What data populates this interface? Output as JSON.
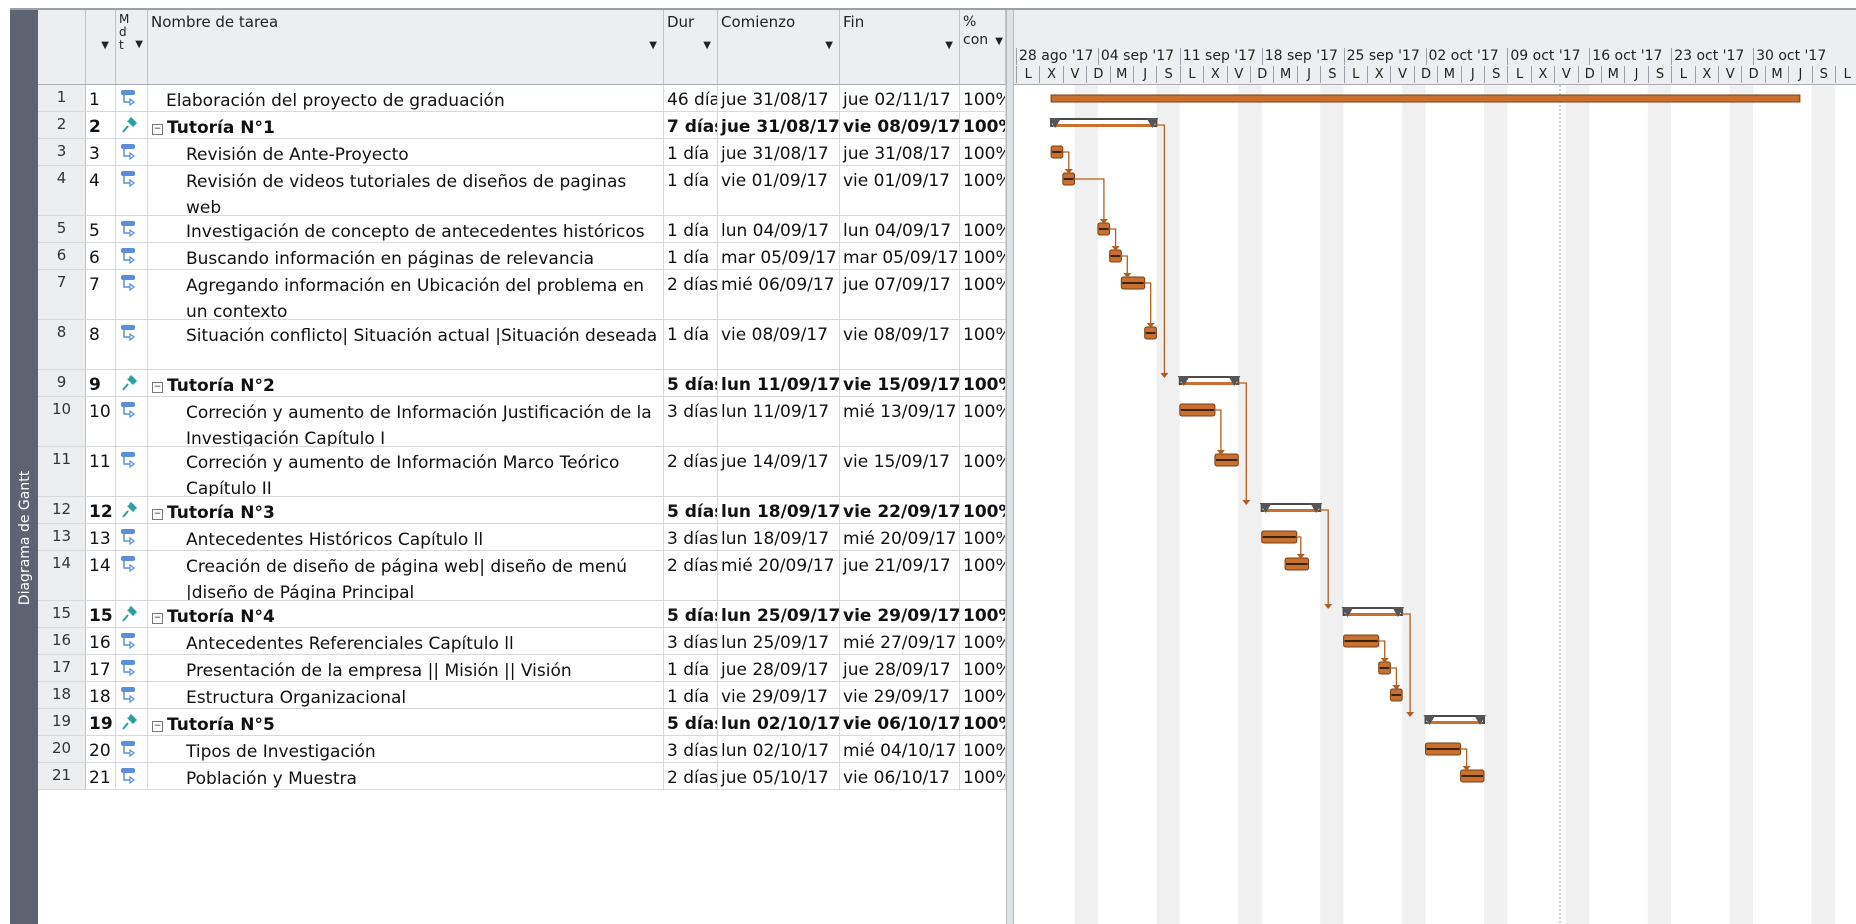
{
  "view_label": "Diagrama de Gantt",
  "columns": {
    "id_header": "",
    "mode_header": "M d t",
    "name_header": "Nombre de tarea",
    "dur_header": "Dur",
    "start_header": "Comienzo",
    "finish_header": "Fin",
    "pct_header": "% con"
  },
  "timescale": {
    "weeks": [
      "28 ago '17",
      "04 sep '17",
      "11 sep '17",
      "18 sep '17",
      "25 sep '17",
      "02 oct '17",
      "09 oct '17",
      "16 oct '17",
      "23 oct '17",
      "30 oct '17"
    ],
    "days": [
      "L",
      "X",
      "V",
      "D",
      "M",
      "J",
      "S"
    ]
  },
  "colors": {
    "bar": "#c8702f",
    "summary_bar": "#4a4a4a",
    "link": "#b35e1e",
    "weekend": "#f0f0f0"
  },
  "tasks": [
    {
      "row": "1",
      "id": "1",
      "name": "Elaboración del proyecto de graduación",
      "dur": "46 días",
      "start": "jue 31/08/17",
      "finish": "jue 02/11/17",
      "pct": "100%",
      "summary": false,
      "level": 0,
      "mode_icon": "auto-scheduled-icon"
    },
    {
      "row": "2",
      "id": "2",
      "name": "Tutoría N°1",
      "dur": "7 días",
      "start": "jue 31/08/17",
      "finish": "vie 08/09/17",
      "pct": "100%",
      "summary": true,
      "level": 0,
      "mode_icon": "manual-pin-icon"
    },
    {
      "row": "3",
      "id": "3",
      "name": "Revisión de Ante-Proyecto",
      "dur": "1 día",
      "start": "jue 31/08/17",
      "finish": "jue 31/08/17",
      "pct": "100%",
      "summary": false,
      "level": 1,
      "mode_icon": "auto-scheduled-icon"
    },
    {
      "row": "4",
      "id": "4",
      "name": "Revisión de videos tutoriales  de diseños de paginas web",
      "dur": "1 día",
      "start": "vie 01/09/17",
      "finish": "vie 01/09/17",
      "pct": "100%",
      "summary": false,
      "level": 1,
      "mode_icon": "auto-scheduled-icon"
    },
    {
      "row": "5",
      "id": "5",
      "name": "Investigación de concepto de antecedentes históricos",
      "dur": "1 día",
      "start": "lun 04/09/17",
      "finish": "lun 04/09/17",
      "pct": "100%",
      "summary": false,
      "level": 1,
      "mode_icon": "auto-scheduled-icon"
    },
    {
      "row": "6",
      "id": "6",
      "name": "Buscando información en páginas de relevancia",
      "dur": "1 día",
      "start": "mar 05/09/17",
      "finish": "mar 05/09/17",
      "pct": "100%",
      "summary": false,
      "level": 1,
      "mode_icon": "auto-scheduled-icon"
    },
    {
      "row": "7",
      "id": "7",
      "name": "Agregando información en Ubicación del problema en un contexto",
      "dur": "2 días",
      "start": "mié 06/09/17",
      "finish": "jue 07/09/17",
      "pct": "100%",
      "summary": false,
      "level": 1,
      "mode_icon": "auto-scheduled-icon"
    },
    {
      "row": "8",
      "id": "8",
      "name": "Situación conflicto| Situación actual |Situación deseada",
      "dur": "1 día",
      "start": "vie 08/09/17",
      "finish": "vie 08/09/17",
      "pct": "100%",
      "summary": false,
      "level": 1,
      "mode_icon": "auto-scheduled-icon"
    },
    {
      "row": "9",
      "id": "9",
      "name": "Tutoría N°2",
      "dur": "5 días",
      "start": "lun 11/09/17",
      "finish": "vie 15/09/17",
      "pct": "100%",
      "summary": true,
      "level": 0,
      "mode_icon": "manual-pin-icon"
    },
    {
      "row": "10",
      "id": "10",
      "name": "Correción y aumento de Información Justificación de la Investigación Capítulo I",
      "dur": "3 días",
      "start": "lun 11/09/17",
      "finish": "mié 13/09/17",
      "pct": "100%",
      "summary": false,
      "level": 1,
      "mode_icon": "auto-scheduled-icon"
    },
    {
      "row": "11",
      "id": "11",
      "name": "Correción y aumento de Información Marco Teórico Capítulo II",
      "dur": "2 días",
      "start": "jue 14/09/17",
      "finish": "vie 15/09/17",
      "pct": "100%",
      "summary": false,
      "level": 1,
      "mode_icon": "auto-scheduled-icon"
    },
    {
      "row": "12",
      "id": "12",
      "name": "Tutoría N°3",
      "dur": "5 días",
      "start": "lun 18/09/17",
      "finish": "vie 22/09/17",
      "pct": "100%",
      "summary": true,
      "level": 0,
      "mode_icon": "manual-pin-icon"
    },
    {
      "row": "13",
      "id": "13",
      "name": "Antecedentes Históricos Capítulo ll",
      "dur": "3 días",
      "start": "lun 18/09/17",
      "finish": "mié 20/09/17",
      "pct": "100%",
      "summary": false,
      "level": 1,
      "mode_icon": "auto-scheduled-icon"
    },
    {
      "row": "14",
      "id": "14",
      "name": "Creación de diseño de página web| diseño de menú |diseño de Página Principal",
      "dur": "2 días",
      "start": "mié 20/09/17",
      "finish": "jue 21/09/17",
      "pct": "100%",
      "summary": false,
      "level": 1,
      "mode_icon": "auto-scheduled-icon"
    },
    {
      "row": "15",
      "id": "15",
      "name": "Tutoría N°4",
      "dur": "5 días",
      "start": "lun 25/09/17",
      "finish": "vie 29/09/17",
      "pct": "100%",
      "summary": true,
      "level": 0,
      "mode_icon": "manual-pin-icon"
    },
    {
      "row": "16",
      "id": "16",
      "name": "Antecedentes Referenciales Capítulo ll",
      "dur": "3 días",
      "start": "lun 25/09/17",
      "finish": "mié 27/09/17",
      "pct": "100%",
      "summary": false,
      "level": 1,
      "mode_icon": "auto-scheduled-icon"
    },
    {
      "row": "17",
      "id": "17",
      "name": "Presentación de la empresa || Misión || Visión",
      "dur": "1 día",
      "start": "jue 28/09/17",
      "finish": "jue 28/09/17",
      "pct": "100%",
      "summary": false,
      "level": 1,
      "mode_icon": "auto-scheduled-icon"
    },
    {
      "row": "18",
      "id": "18",
      "name": "Estructura Organizacional",
      "dur": "1 día",
      "start": "vie 29/09/17",
      "finish": "vie 29/09/17",
      "pct": "100%",
      "summary": false,
      "level": 1,
      "mode_icon": "auto-scheduled-icon"
    },
    {
      "row": "19",
      "id": "19",
      "name": "Tutoría N°5",
      "dur": "5 días",
      "start": "lun 02/10/17",
      "finish": "vie 06/10/17",
      "pct": "100%",
      "summary": true,
      "level": 0,
      "mode_icon": "manual-pin-icon"
    },
    {
      "row": "20",
      "id": "20",
      "name": "Tipos de Investigación",
      "dur": "3 días",
      "start": "lun 02/10/17",
      "finish": "mié 04/10/17",
      "pct": "100%",
      "summary": false,
      "level": 1,
      "mode_icon": "auto-scheduled-icon"
    },
    {
      "row": "21",
      "id": "21",
      "name": "Población y Muestra",
      "dur": "2 días",
      "start": "jue 05/10/17",
      "finish": "vie 06/10/17",
      "pct": "100%",
      "summary": false,
      "level": 1,
      "mode_icon": "auto-scheduled-icon"
    }
  ]
}
